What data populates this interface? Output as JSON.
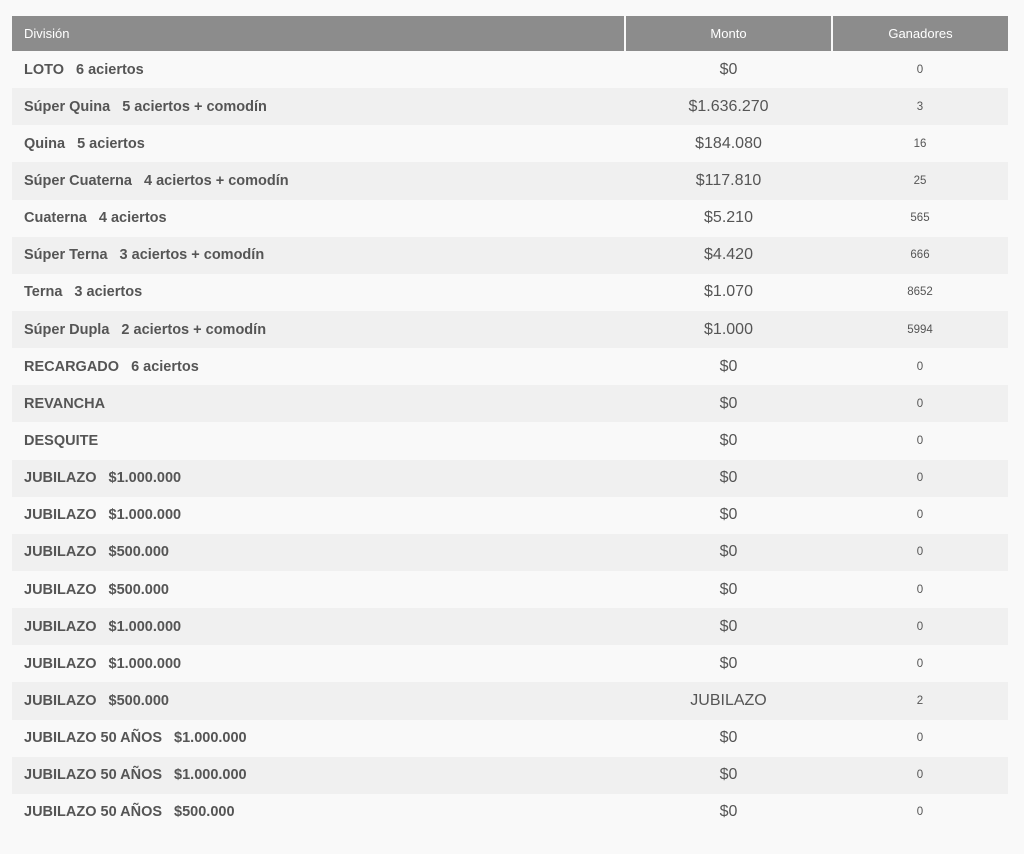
{
  "table": {
    "headers": {
      "division": "División",
      "monto": "Monto",
      "ganadores": "Ganadores"
    },
    "rows": [
      {
        "name": "LOTO",
        "detail": "6 aciertos",
        "monto": "$0",
        "ganadores": "0"
      },
      {
        "name": "Súper Quina",
        "detail": "5 aciertos + comodín",
        "monto": "$1.636.270",
        "ganadores": "3"
      },
      {
        "name": "Quina",
        "detail": "5 aciertos",
        "monto": "$184.080",
        "ganadores": "16"
      },
      {
        "name": "Súper Cuaterna",
        "detail": "4 aciertos + comodín",
        "monto": "$117.810",
        "ganadores": "25"
      },
      {
        "name": "Cuaterna",
        "detail": "4 aciertos",
        "monto": "$5.210",
        "ganadores": "565"
      },
      {
        "name": "Súper Terna",
        "detail": "3 aciertos + comodín",
        "monto": "$4.420",
        "ganadores": "666"
      },
      {
        "name": "Terna",
        "detail": "3 aciertos",
        "monto": "$1.070",
        "ganadores": "8652"
      },
      {
        "name": "Súper Dupla",
        "detail": "2 aciertos + comodín",
        "monto": "$1.000",
        "ganadores": "5994"
      },
      {
        "name": "RECARGADO",
        "detail": "6 aciertos",
        "monto": "$0",
        "ganadores": "0"
      },
      {
        "name": "REVANCHA",
        "detail": "",
        "monto": "$0",
        "ganadores": "0"
      },
      {
        "name": "DESQUITE",
        "detail": "",
        "monto": "$0",
        "ganadores": "0"
      },
      {
        "name": "JUBILAZO",
        "detail": "$1.000.000",
        "monto": "$0",
        "ganadores": "0"
      },
      {
        "name": "JUBILAZO",
        "detail": "$1.000.000",
        "monto": "$0",
        "ganadores": "0"
      },
      {
        "name": "JUBILAZO",
        "detail": "$500.000",
        "monto": "$0",
        "ganadores": "0"
      },
      {
        "name": "JUBILAZO",
        "detail": "$500.000",
        "monto": "$0",
        "ganadores": "0"
      },
      {
        "name": "JUBILAZO",
        "detail": "$1.000.000",
        "monto": "$0",
        "ganadores": "0"
      },
      {
        "name": "JUBILAZO",
        "detail": "$1.000.000",
        "monto": "$0",
        "ganadores": "0"
      },
      {
        "name": "JUBILAZO",
        "detail": "$500.000",
        "monto": "JUBILAZO",
        "ganadores": "2"
      },
      {
        "name": "JUBILAZO 50 AÑOS",
        "detail": "$1.000.000",
        "monto": "$0",
        "ganadores": "0"
      },
      {
        "name": "JUBILAZO 50 AÑOS",
        "detail": "$1.000.000",
        "monto": "$0",
        "ganadores": "0"
      },
      {
        "name": "JUBILAZO 50 AÑOS",
        "detail": "$500.000",
        "monto": "$0",
        "ganadores": "0"
      }
    ]
  }
}
